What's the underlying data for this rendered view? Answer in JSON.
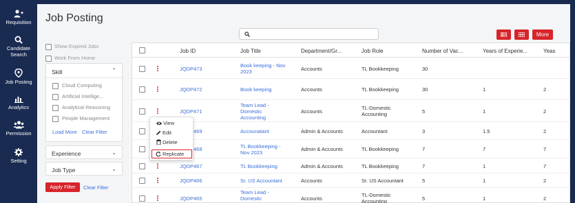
{
  "sidebar": {
    "items": [
      {
        "label": "Requisition",
        "icon": "user-plus-icon"
      },
      {
        "label": "Candidate Search",
        "icon": "search-icon"
      },
      {
        "label": "Job Posting",
        "icon": "location-pin-icon"
      },
      {
        "label": "Analytics",
        "icon": "bar-chart-icon"
      },
      {
        "label": "Permission",
        "icon": "users-group-icon"
      },
      {
        "label": "Setting",
        "icon": "gear-icon"
      }
    ]
  },
  "page": {
    "title": "Job Posting"
  },
  "search": {
    "placeholder": "",
    "value": ""
  },
  "toolbar": {
    "more_label": "More",
    "accent": "#d7242a"
  },
  "filters": {
    "show_expired": "Show Expired Jobs",
    "work_from_home": "Work From Home",
    "skill": {
      "title": "Skill",
      "items": [
        "Cloud Computing",
        "Artificial Intellige...",
        "Analytical Reasoning",
        "People Management"
      ],
      "load_more": "Load More",
      "clear": "Clear Filter"
    },
    "experience": "Experience",
    "job_type": "Job Type",
    "apply": "Apply Filter",
    "clear": "Clear Filter"
  },
  "table": {
    "headers": [
      "Job ID",
      "Job Title",
      "Department/Gr...",
      "Job Role",
      "Number of Vac...",
      "Years of Experie...",
      "Yeas"
    ],
    "rows": [
      {
        "id": "JQDP473",
        "title": [
          "Book keeping - Nov",
          "2023"
        ],
        "dept": "Accounts",
        "role": [
          "TL Bookkeeping"
        ],
        "vac": "30",
        "exp": "",
        "yrs": ""
      },
      {
        "id": "JQDP472",
        "title": [
          "Book keeping"
        ],
        "dept": "Accounts",
        "role": [
          "TL Bookkeeping"
        ],
        "vac": "30",
        "exp": "1",
        "yrs": "2"
      },
      {
        "id": "JQDP471",
        "title": [
          "Team Lead -",
          "Domestic",
          "Accounting"
        ],
        "dept": "Accounts",
        "role": [
          "TL-Domestic",
          "Accounting"
        ],
        "vac": "5",
        "exp": "1",
        "yrs": "2"
      },
      {
        "id": "JQDP469",
        "title": [
          "Accounatant"
        ],
        "dept": "Admin & Accounts",
        "role": [
          "Accountant"
        ],
        "vac": "3",
        "exp": "1.5",
        "yrs": "2"
      },
      {
        "id": "JQDP468",
        "title": [
          "TL Bookkeeping -",
          "Nov 2023"
        ],
        "dept": "Admin & Accounts",
        "role": [
          "TL Bookkeeping"
        ],
        "vac": "7",
        "exp": "7",
        "yrs": "7"
      },
      {
        "id": "JQDP467",
        "title": [
          "TL Bookkeeping"
        ],
        "dept": "Admin & Accounts",
        "role": [
          "TL Bookkeeping"
        ],
        "vac": "7",
        "exp": "1",
        "yrs": "7"
      },
      {
        "id": "JQDP466",
        "title": [
          "Sr. US Accountant"
        ],
        "dept": "Accounts",
        "role": [
          "Sr. US Accountant"
        ],
        "vac": "5",
        "exp": "1",
        "yrs": "2"
      },
      {
        "id": "JQDP465",
        "title": [
          "Team Lead -",
          "Domestic",
          "Accounting"
        ],
        "dept": "Accounts",
        "role": [
          "TL-Domestic",
          "Accounting"
        ],
        "vac": "5",
        "exp": "1",
        "yrs": "2"
      }
    ]
  },
  "context_menu": {
    "view": "View",
    "edit": "Edit",
    "delete": "Delete",
    "replicate": "Replicate"
  }
}
